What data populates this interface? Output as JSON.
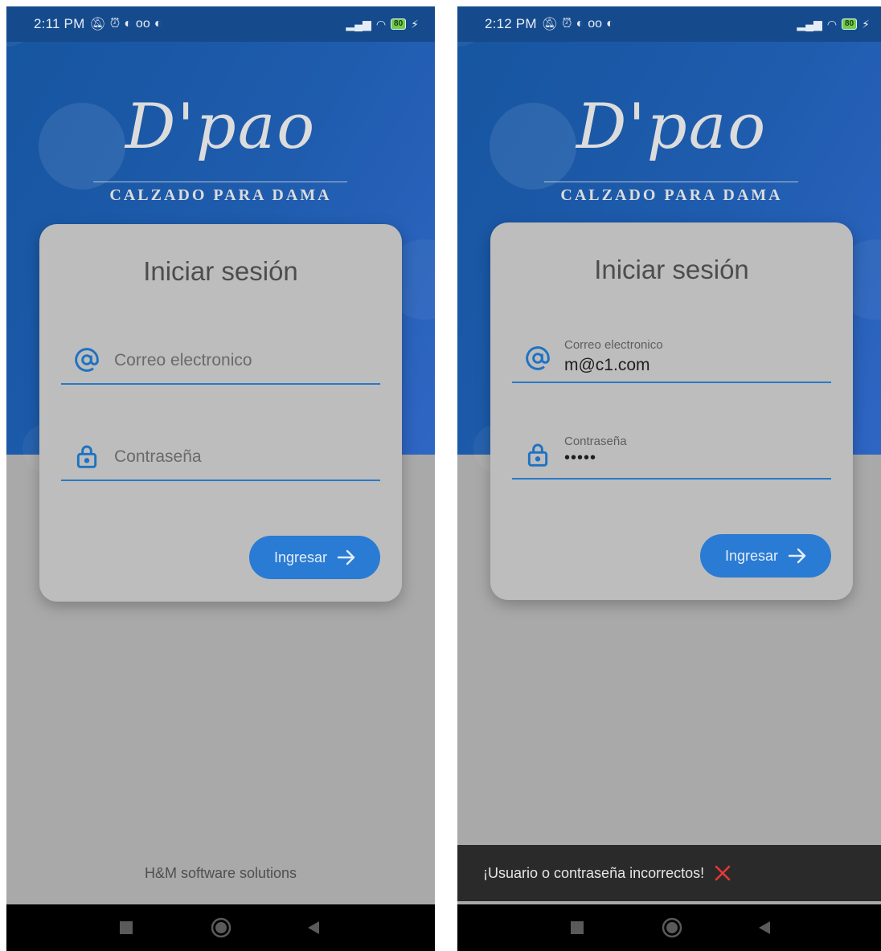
{
  "screens": [
    {
      "status": {
        "time": "2:11 PM",
        "battery": "80"
      },
      "logo": {
        "script": "D'pao",
        "subtitle": "CALZADO PARA DAMA"
      },
      "card": {
        "title": "Iniciar sesión"
      },
      "email": {
        "placeholder": "Correo electronico"
      },
      "password": {
        "placeholder": "Contraseña"
      },
      "button": {
        "label": "Ingresar"
      },
      "footer": "H&M software solutions"
    },
    {
      "status": {
        "time": "2:12 PM",
        "battery": "80"
      },
      "logo": {
        "script": "D'pao",
        "subtitle": "CALZADO PARA DAMA"
      },
      "card": {
        "title": "Iniciar sesión"
      },
      "email": {
        "label": "Correo electronico",
        "value": "m@c1.com"
      },
      "password": {
        "label": "Contraseña",
        "value": "•••••"
      },
      "button": {
        "label": "Ingresar"
      },
      "snackbar": {
        "message": "¡Usuario o contraseña incorrectos!"
      }
    }
  ],
  "colors": {
    "primary": "#2a7bd3",
    "hero": "#1f5cae",
    "error": "#e53935"
  },
  "icons": {
    "email": "at-sign-icon",
    "password": "lock-icon",
    "arrow": "arrow-right-icon",
    "error": "close-icon"
  }
}
